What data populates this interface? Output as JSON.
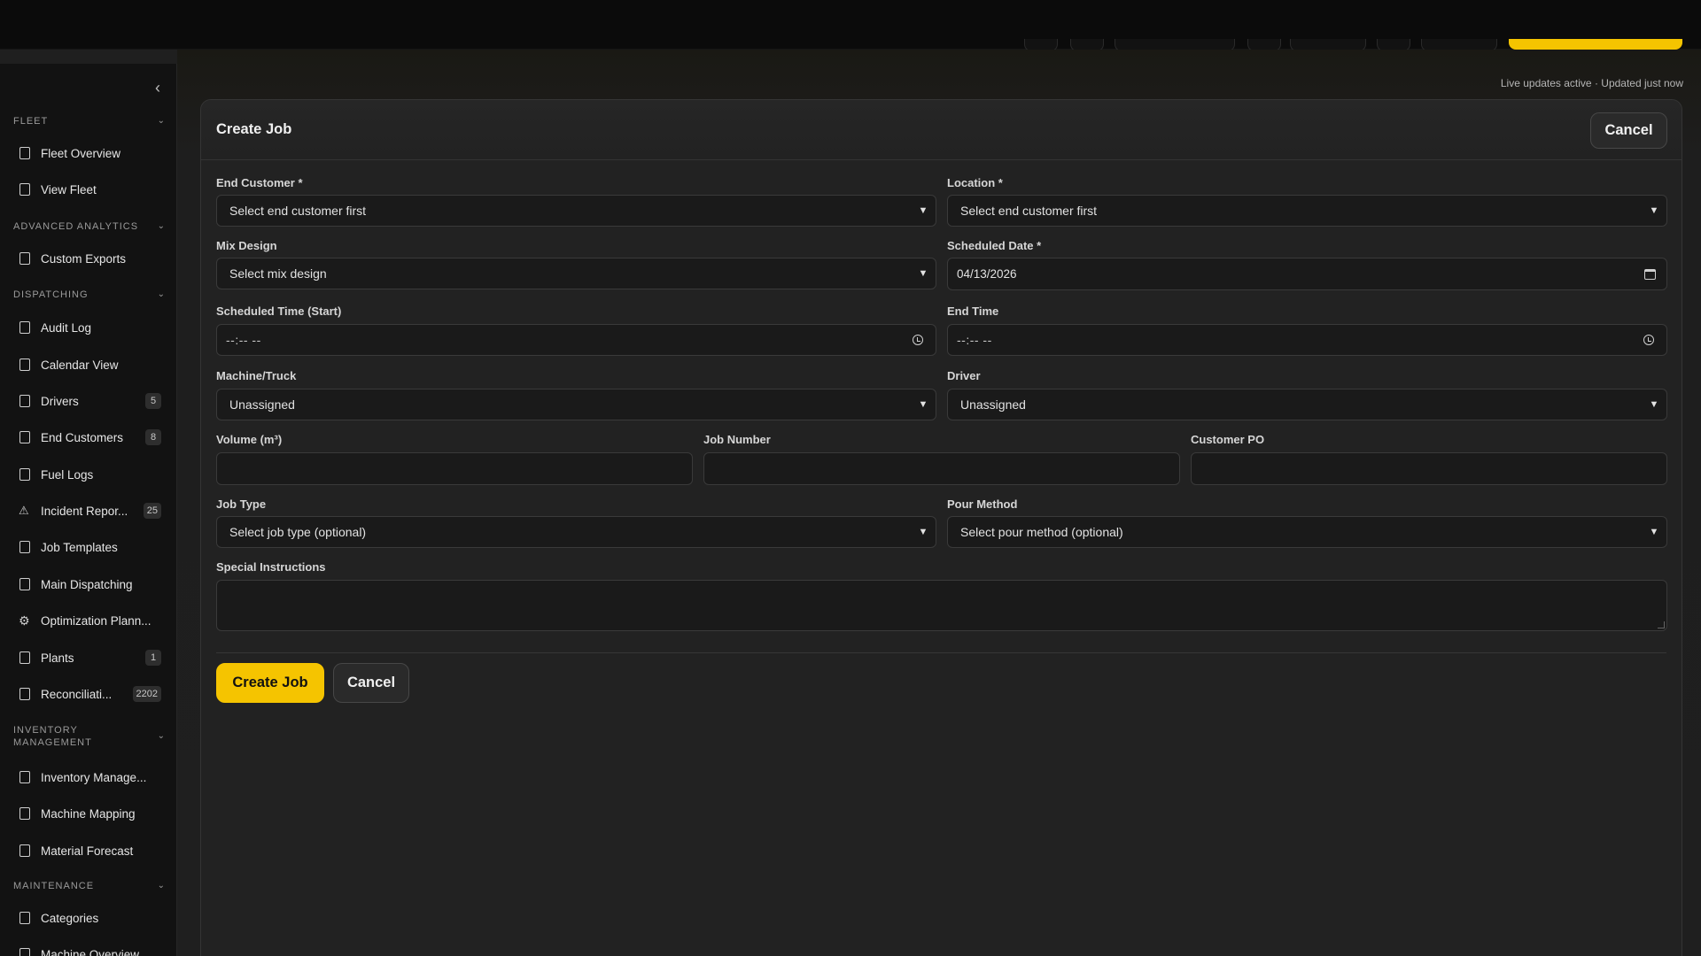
{
  "live_status": "Live updates active · Updated just now",
  "sidebar": {
    "collapse_icon": "chevron-left-icon",
    "sections": [
      {
        "title": "FLEET"
      },
      {
        "title": "ADVANCED ANALYTICS"
      },
      {
        "title": "DISPATCHING"
      },
      {
        "title": "INVENTORY MANAGEMENT"
      },
      {
        "title": "MAINTENANCE"
      }
    ],
    "items": [
      {
        "label": "Fleet Overview",
        "badge": ""
      },
      {
        "label": "View Fleet",
        "badge": ""
      },
      {
        "label": "Custom Exports",
        "badge": ""
      },
      {
        "label": "Audit Log",
        "badge": ""
      },
      {
        "label": "Calendar View",
        "badge": ""
      },
      {
        "label": "Drivers",
        "badge": "5"
      },
      {
        "label": "End Customers",
        "badge": "8"
      },
      {
        "label": "Fuel Logs",
        "badge": ""
      },
      {
        "label": "Incident Repor...",
        "badge": "25"
      },
      {
        "label": "Job Templates",
        "badge": ""
      },
      {
        "label": "Main Dispatching",
        "badge": ""
      },
      {
        "label": "Optimization Plann...",
        "badge": ""
      },
      {
        "label": "Plants",
        "badge": "1"
      },
      {
        "label": "Reconciliati...",
        "badge": "2202"
      },
      {
        "label": "Inventory Manage...",
        "badge": ""
      },
      {
        "label": "Machine Mapping",
        "badge": ""
      },
      {
        "label": "Material Forecast",
        "badge": ""
      },
      {
        "label": "Categories",
        "badge": ""
      },
      {
        "label": "Machine Overview",
        "badge": ""
      }
    ]
  },
  "form": {
    "title": "Create Job",
    "header_cancel": "Cancel",
    "end_customer": {
      "label": "End Customer *",
      "value": "Select end customer first"
    },
    "location": {
      "label": "Location *",
      "value": "Select end customer first"
    },
    "mix_design": {
      "label": "Mix Design",
      "value": "Select mix design"
    },
    "scheduled_date": {
      "label": "Scheduled Date *",
      "value": "04/13/2026"
    },
    "scheduled_time": {
      "label": "Scheduled Time (Start)",
      "value": "--:-- --"
    },
    "end_time": {
      "label": "End Time",
      "value": "--:-- --"
    },
    "machine": {
      "label": "Machine/Truck",
      "value": "Unassigned"
    },
    "driver": {
      "label": "Driver",
      "value": "Unassigned"
    },
    "volume": {
      "label": "Volume (m³)",
      "value": ""
    },
    "job_number": {
      "label": "Job Number",
      "value": ""
    },
    "customer_po": {
      "label": "Customer PO",
      "value": ""
    },
    "job_type": {
      "label": "Job Type",
      "value": "Select job type (optional)"
    },
    "pour_method": {
      "label": "Pour Method",
      "value": "Select pour method (optional)"
    },
    "special_instructions": {
      "label": "Special Instructions",
      "value": ""
    },
    "submit_label": "Create Job",
    "cancel_label": "Cancel"
  },
  "colors": {
    "accent": "#f5c400",
    "background": "#1f1f1f",
    "sidebar": "#121212"
  }
}
